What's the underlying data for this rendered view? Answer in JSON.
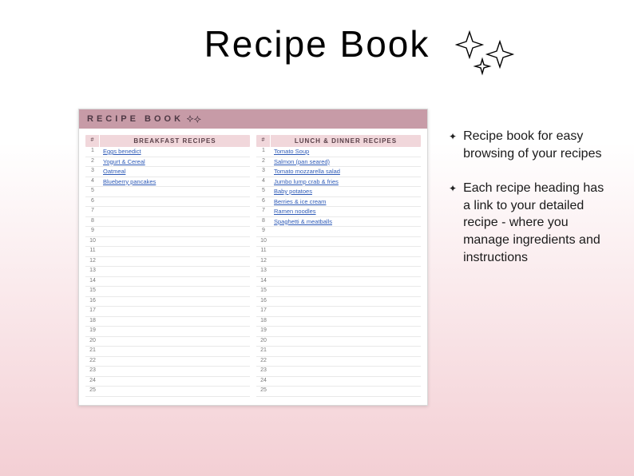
{
  "page_title": "Recipe Book",
  "sheet": {
    "header": "RECIPE BOOK",
    "rows_per_column": 25,
    "columns": [
      {
        "num_header": "#",
        "title": "BREAKFAST RECIPES",
        "items": [
          "Eggs benedict",
          "Yogurt & Cereal",
          "Oatmeal",
          "Blueberry pancakes"
        ]
      },
      {
        "num_header": "#",
        "title": "LUNCH & DINNER RECIPES",
        "items": [
          "Tomato Soup",
          "Salmon (pan seared)",
          "Tomato mozzarella salad",
          "Jumbo lump crab & fries",
          "Baby potatoes",
          "Berries & ice cream",
          "Ramen noodles",
          "Spaghetti & meatballs"
        ]
      }
    ]
  },
  "bullets": [
    "Recipe book for easy browsing of your recipes",
    "Each recipe heading has a link to your detailed recipe - where you manage ingredients and instructions"
  ]
}
